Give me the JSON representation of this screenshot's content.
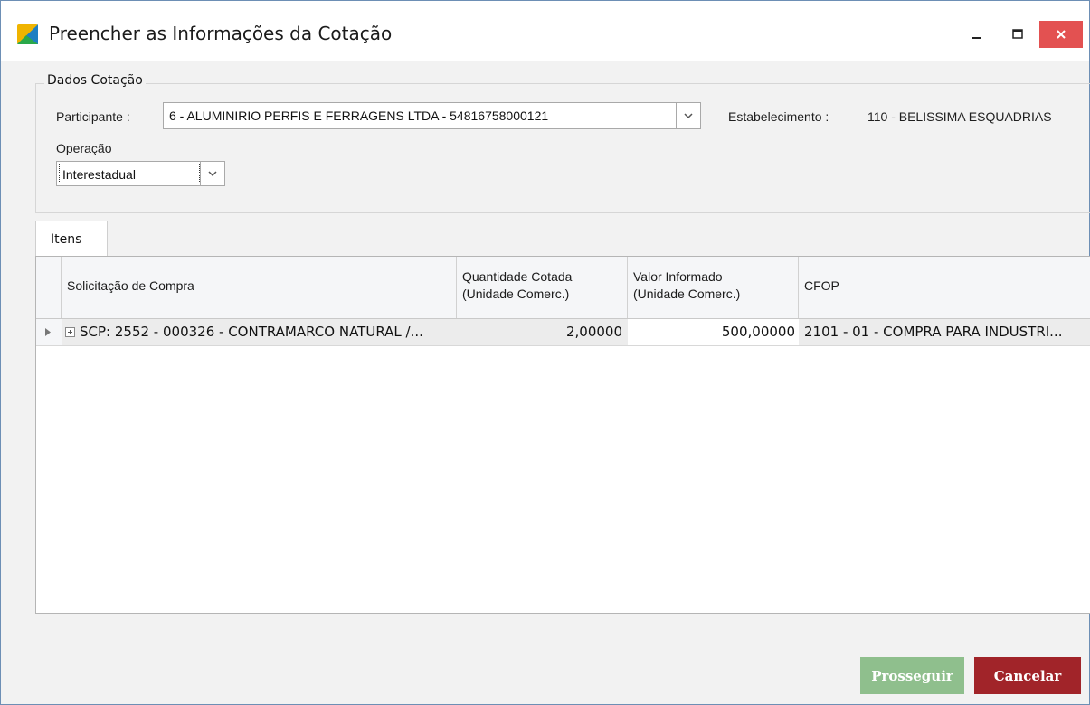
{
  "window": {
    "title": "Preencher as Informações da Cotação",
    "controls": {
      "minimize": "minimize-icon",
      "maximize": "maximize-icon",
      "close": "close-icon"
    },
    "colors": {
      "close_bg": "#e35151",
      "border": "#6d8fb5"
    }
  },
  "dados": {
    "group_title": "Dados Cotação",
    "participante_label": "Participante :",
    "participante_value": "6 - ALUMINIRIO PERFIS E FERRAGENS LTDA - 54816758000121",
    "estabelecimento_label": "Estabelecimento :",
    "estabelecimento_value": "110 - BELISSIMA ESQUADRIAS",
    "operacao_label": "Operação",
    "operacao_value": "Interestadual"
  },
  "tabs": [
    {
      "label": "Itens",
      "active": true
    }
  ],
  "grid": {
    "columns": [
      {
        "line1": "Solicitação de Compra",
        "line2": ""
      },
      {
        "line1": "Quantidade Cotada",
        "line2": "(Unidade Comerc.)"
      },
      {
        "line1": "Valor Informado",
        "line2": "(Unidade Comerc.)"
      },
      {
        "line1": "CFOP",
        "line2": ""
      }
    ],
    "rows": [
      {
        "solicitacao": "SCP: 2552 - 000326 - CONTRAMARCO NATURAL /...",
        "quantidade": "2,00000",
        "valor": "500,00000",
        "cfop": "2101 - 01 - COMPRA PARA INDUSTRI..."
      }
    ]
  },
  "buttons": {
    "prosseguir": "Prosseguir",
    "cancelar": "Cancelar",
    "colors": {
      "prosseguir": "#8fbf8d",
      "cancelar": "#a12429"
    }
  }
}
